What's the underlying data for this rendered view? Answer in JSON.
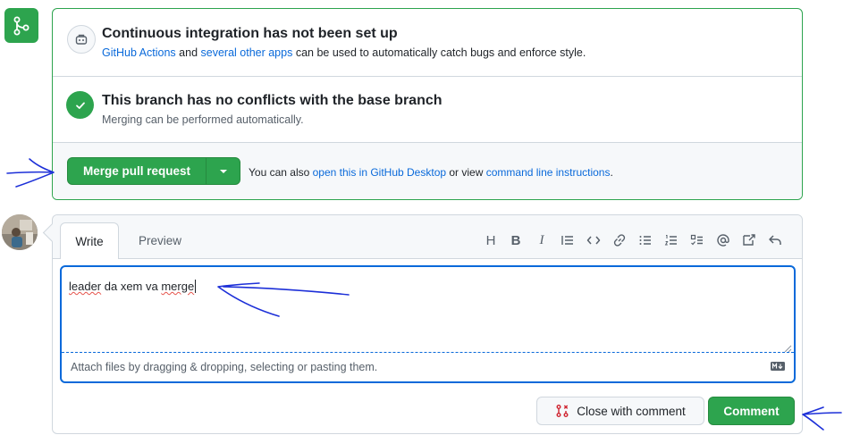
{
  "ci": {
    "title": "Continuous integration has not been set up",
    "link1": "GitHub Actions",
    "text1": " and ",
    "link2": "several other apps",
    "text2": " can be used to automatically catch bugs and enforce style."
  },
  "conflicts": {
    "title": "This branch has no conflicts with the base branch",
    "desc": "Merging can be performed automatically."
  },
  "merge": {
    "button_label": "Merge pull request",
    "hint_prefix": "You can also ",
    "hint_link1": "open this in GitHub Desktop",
    "hint_mid": " or view ",
    "hint_link2": "command line instructions",
    "hint_suffix": "."
  },
  "comment": {
    "tabs": {
      "write": "Write",
      "preview": "Preview"
    },
    "toolbar": {
      "heading": "H",
      "bold": "B",
      "italic": "I",
      "icons": [
        "quote-icon",
        "code-icon",
        "link-icon",
        "bulleted-list-icon",
        "numbered-list-icon",
        "task-list-icon",
        "mention-icon",
        "cross-reference-icon",
        "saved-reply-icon"
      ]
    },
    "text_value_part1": "leader",
    "text_value_part2": " da xem va ",
    "text_value_part3": "merge",
    "attach_hint": "Attach files by dragging & dropping, selecting or pasting them.",
    "close_label": "Close with comment",
    "comment_label": "Comment"
  },
  "colors": {
    "success": "#2da44e",
    "link": "#0969da",
    "focus": "#0969da",
    "annotation": "#1c2fd8"
  }
}
